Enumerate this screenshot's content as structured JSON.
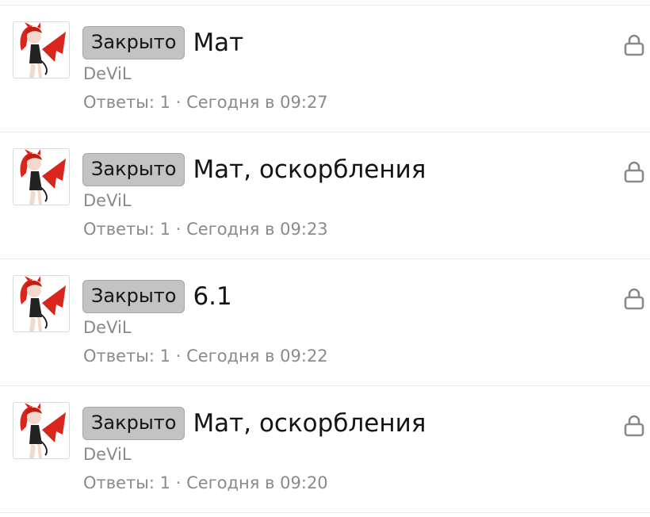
{
  "threads": [
    {
      "status_badge": "Закрыто",
      "title": "Мат",
      "author": "DeViL",
      "replies_label": "Ответы:",
      "replies": "1",
      "separator": "·",
      "date": "Сегодня в 09:27",
      "avatar_icon": "devil-avatar-icon",
      "lock_icon": "lock-icon"
    },
    {
      "status_badge": "Закрыто",
      "title": "Мат, оскорбления",
      "author": "DeViL",
      "replies_label": "Ответы:",
      "replies": "1",
      "separator": "·",
      "date": "Сегодня в 09:23",
      "avatar_icon": "devil-avatar-icon",
      "lock_icon": "lock-icon"
    },
    {
      "status_badge": "Закрыто",
      "title": "6.1",
      "author": "DeViL",
      "replies_label": "Ответы:",
      "replies": "1",
      "separator": "·",
      "date": "Сегодня в 09:22",
      "avatar_icon": "devil-avatar-icon",
      "lock_icon": "lock-icon"
    },
    {
      "status_badge": "Закрыто",
      "title": "Мат, оскорбления",
      "author": "DeViL",
      "replies_label": "Ответы:",
      "replies": "1",
      "separator": "·",
      "date": "Сегодня в 09:20",
      "avatar_icon": "devil-avatar-icon",
      "lock_icon": "lock-icon"
    }
  ],
  "colors": {
    "badge_bg": "#c3c3c3",
    "muted_text": "#8a8a8a",
    "avatar_red": "#d8261c",
    "divider": "#e8e8e8"
  }
}
